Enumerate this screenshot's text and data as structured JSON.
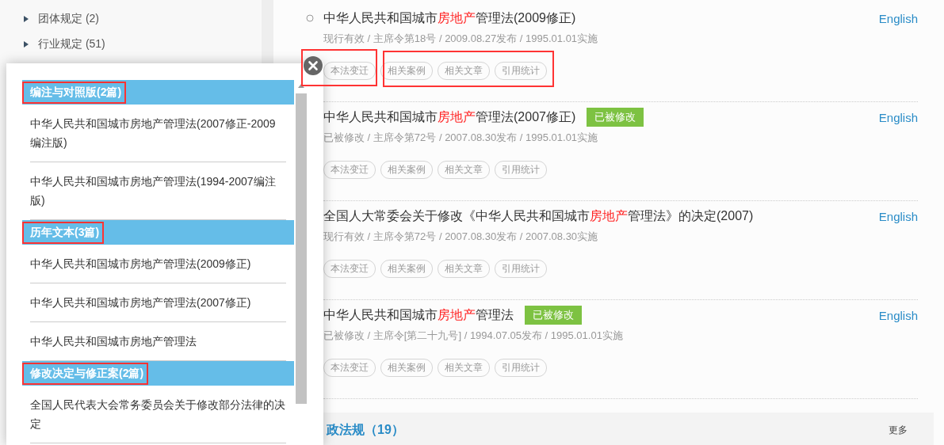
{
  "sidebar": {
    "items": [
      {
        "label": "团体规定 (2)"
      },
      {
        "label": "行业规定 (51)"
      }
    ]
  },
  "results": [
    {
      "title": [
        {
          "text": "中华人民共和国城市",
          "highlight": false
        },
        {
          "text": "房地产",
          "highlight": true
        },
        {
          "text": "管理法(2009修正)",
          "highlight": false
        }
      ],
      "meta": "现行有效 / 主席令第18号 / 2009.08.27发布 / 1995.01.01实施",
      "tags": [
        "本法变迁",
        "相关案例",
        "相关文章",
        "引用统计"
      ],
      "link": "English"
    },
    {
      "title": [
        {
          "text": "中华人民共和国城市",
          "highlight": false
        },
        {
          "text": "房地产",
          "highlight": true
        },
        {
          "text": "管理法(2007修正)",
          "highlight": false
        }
      ],
      "badge": "已被修改",
      "meta": "已被修改 / 主席令第72号 / 2007.08.30发布 / 1995.01.01实施",
      "tags": [
        "本法变迁",
        "相关案例",
        "相关文章",
        "引用统计"
      ],
      "link": "English"
    },
    {
      "title": [
        {
          "text": "全国人大常委会关于修改《中华人民共和国城市",
          "highlight": false
        },
        {
          "text": "房地产",
          "highlight": true
        },
        {
          "text": "管理法》的决定(2007)",
          "highlight": false
        }
      ],
      "meta": "现行有效 / 主席令第72号 / 2007.08.30发布 / 2007.08.30实施",
      "tags": [
        "本法变迁",
        "相关案例",
        "相关文章",
        "引用统计"
      ],
      "link": "English"
    },
    {
      "title": [
        {
          "text": "中华人民共和国城市",
          "highlight": false
        },
        {
          "text": "房地产",
          "highlight": true
        },
        {
          "text": "管理法",
          "highlight": false
        }
      ],
      "badge": "已被修改",
      "meta": "已被修改 / 主席令[第二十九号] / 1994.07.05发布 / 1995.01.01实施",
      "tags": [
        "本法变迁",
        "相关案例",
        "相关文章",
        "引用统计"
      ],
      "link": "English"
    }
  ],
  "next_section": {
    "title": "政法规（19）",
    "more": "更多"
  },
  "popup": {
    "sections": [
      {
        "heading": "编注与对照版(2篇)",
        "outlined": true,
        "items": [
          "中华人民共和国城市房地产管理法(2007修正-2009编注版)",
          "中华人民共和国城市房地产管理法(1994-2007编注版)"
        ]
      },
      {
        "heading": "历年文本(3篇)",
        "outlined": true,
        "items": [
          "中华人民共和国城市房地产管理法(2009修正)",
          "中华人民共和国城市房地产管理法(2007修正)",
          "中华人民共和国城市房地产管理法"
        ]
      },
      {
        "heading": "修改决定与修正案(2篇)",
        "outlined": true,
        "items": [
          "全国人民代表大会常务委员会关于修改部分法律的决定"
        ]
      }
    ]
  }
}
